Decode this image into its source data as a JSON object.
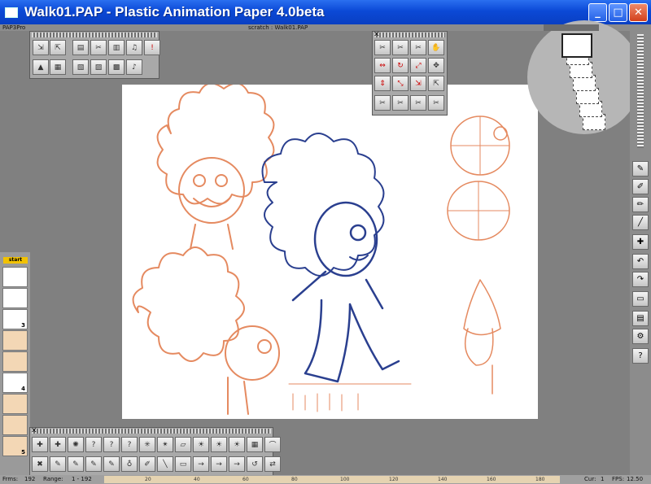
{
  "window": {
    "title": "Walk01.PAP - Plastic Animation Paper 4.0beta",
    "minimize": "_",
    "maximize": "□",
    "close": "✕"
  },
  "menubar": {
    "left": "PAP3Pro",
    "center": "scratch : Walk01.PAP"
  },
  "status": {
    "frms_label": "Frms:",
    "frms_value": "192",
    "range_label": "Range:",
    "range_value": "1 - 192",
    "cur_label": "Cur:",
    "cur_value": "1",
    "fps_label": "FPS:",
    "fps_value": "12.50"
  },
  "ruler": {
    "ticks": [
      "20",
      "40",
      "60",
      "80",
      "100",
      "120",
      "140",
      "160",
      "180"
    ]
  },
  "timeline": {
    "start_label": "start",
    "frames": [
      "",
      "",
      "3",
      "",
      "",
      "4",
      "",
      "",
      "5"
    ]
  },
  "colors": {
    "orange": "#e58a60",
    "blue": "#2a3f8f",
    "titlebar": "#0b49d6"
  }
}
